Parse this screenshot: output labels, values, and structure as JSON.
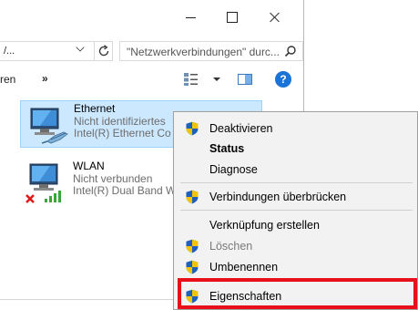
{
  "window": {
    "controls": {
      "minimize": "minimize",
      "maximize": "maximize",
      "close": "close"
    },
    "address": {
      "value": "/..."
    },
    "search": {
      "placeholder": "\"Netzwerkverbindungen\" durc..."
    },
    "commandbar": {
      "truncated_label": "ren",
      "more_label": "»"
    }
  },
  "connections": [
    {
      "name": "Ethernet",
      "status": "Nicht identifiziertes",
      "device": "Intel(R) Ethernet Co",
      "selected": true
    },
    {
      "name": "WLAN",
      "status": "Nicht verbunden",
      "device": "Intel(R) Dual Band W",
      "selected": false
    }
  ],
  "context_menu": {
    "items": [
      {
        "label": "Deaktivieren",
        "shield": true,
        "bold": false,
        "disabled": false
      },
      {
        "label": "Status",
        "shield": false,
        "bold": true,
        "disabled": false
      },
      {
        "label": "Diagnose",
        "shield": false,
        "bold": false,
        "disabled": false
      },
      {
        "label": "Verbindungen überbrücken",
        "shield": true,
        "bold": false,
        "disabled": false
      },
      {
        "label": "Verknüpfung erstellen",
        "shield": false,
        "bold": false,
        "disabled": false
      },
      {
        "label": "Löschen",
        "shield": true,
        "bold": false,
        "disabled": true
      },
      {
        "label": "Umbenennen",
        "shield": true,
        "bold": false,
        "disabled": false
      },
      {
        "label": "Eigenschaften",
        "shield": true,
        "bold": false,
        "disabled": false
      }
    ]
  },
  "colors": {
    "selection_bg": "#cce8ff",
    "highlight_box": "#e8101a",
    "help_blue": "#1a73d6",
    "shield_blue": "#1f5fbf",
    "shield_yellow": "#f5c400"
  }
}
